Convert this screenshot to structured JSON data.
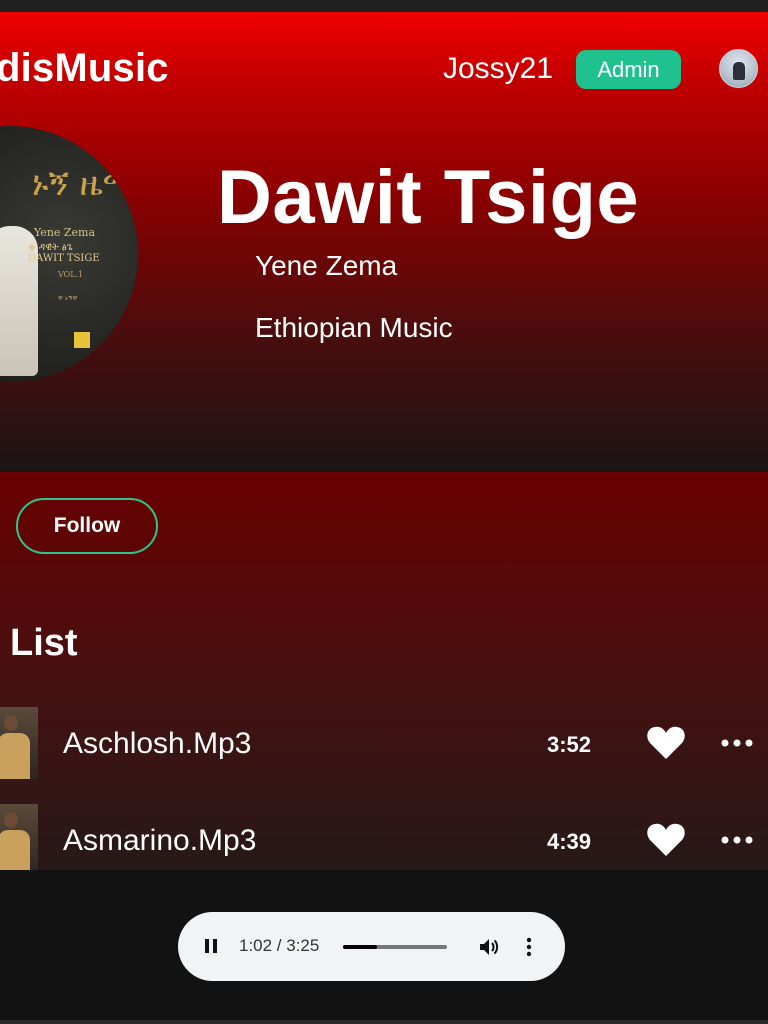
{
  "header": {
    "brand": "disMusic",
    "username": "Jossy21",
    "role_badge": "Admin"
  },
  "artist": {
    "name": "Dawit Tsige",
    "album": "Yene Zema",
    "genre": "Ethiopian Music"
  },
  "album_art": {
    "title_glyphs": "ኑኝ ዜማ",
    "subtitle": "Yene Zema",
    "artist_glyphs": "◆ ዳዊት ፅጌ",
    "artist_latin": "DAWIT TSIGE",
    "volume": "VOL.1",
    "small_text": "ዋ ኑኝዋ"
  },
  "actions": {
    "follow_label": "Follow"
  },
  "list": {
    "title": "List",
    "tracks": [
      {
        "title": "Aschlosh.Mp3",
        "duration": "3:52"
      },
      {
        "title": "Asmarino.Mp3",
        "duration": "4:39"
      }
    ]
  },
  "player": {
    "time": "1:02 / 3:25",
    "progress": 0.33,
    "state": "playing"
  },
  "colors": {
    "accent": "#1fc28f",
    "follow_border": "#2ec48d",
    "hero_top": "#f20000",
    "player_bg": "#f1f3f4"
  },
  "icons": {
    "avatar": "user-avatar",
    "heart": "heart-icon",
    "more": "more-horizontal-icon",
    "pause": "pause-icon",
    "volume": "volume-icon",
    "menu": "more-vertical-icon"
  }
}
